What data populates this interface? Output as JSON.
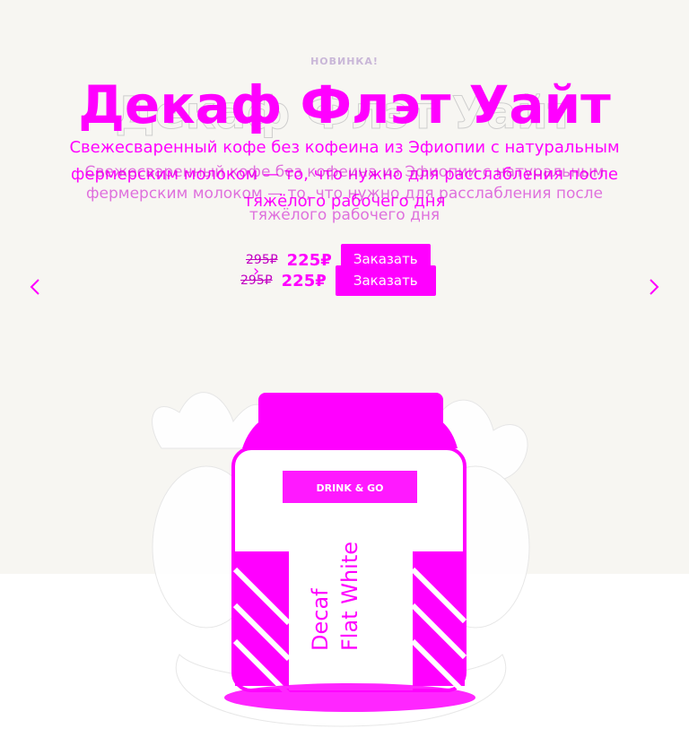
{
  "hero": {
    "badge": "НОВИНКА!",
    "title": "Декаф Флэт Уайт",
    "description": "Свежесваренный кофе без кофеина из Эфиопии с натуральным фермерским молоком — то, что нужно для расслабления после тяжёлого рабочего дня",
    "description_ghost": "Свежесваренный кофе без кофеина из Эфиопии с натуральным фермерским молоком — то, что нужно для расслабления после тяжёлого рабочего дня",
    "old_price": "295₽",
    "new_price": "225₽",
    "order_label": "Заказать"
  },
  "product": {
    "brand": "DRINK & GO",
    "name_line1": "Decaf",
    "name_line2": "Flat White"
  },
  "colors": {
    "accent": "#ff00ff",
    "background": "#f7f6f2"
  },
  "icons": {
    "prev": "chevron-left-icon",
    "next": "chevron-right-icon"
  }
}
